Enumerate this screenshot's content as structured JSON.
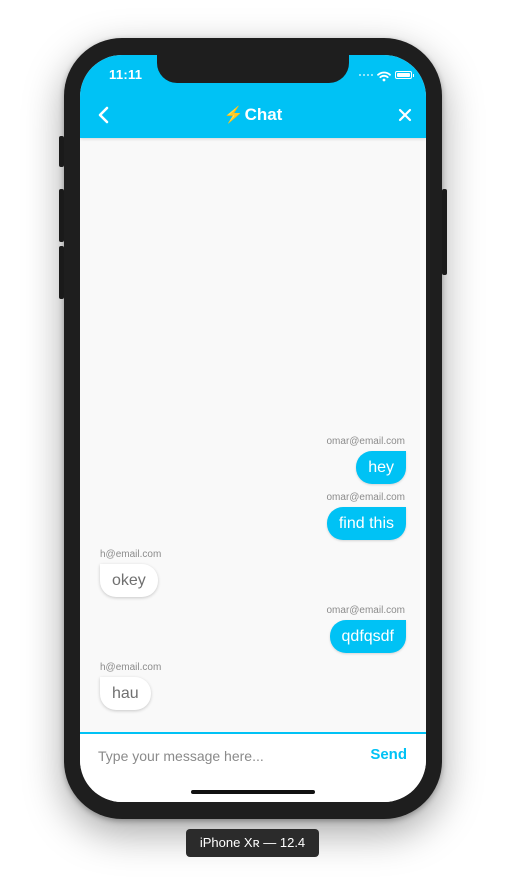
{
  "status_bar": {
    "time": "11:11",
    "icons": [
      "signal-icon",
      "wifi-icon",
      "battery-icon"
    ]
  },
  "nav": {
    "back_icon": "chevron-left-icon",
    "title_emoji": "⚡",
    "title": "Chat",
    "close_icon": "close-icon"
  },
  "messages": [
    {
      "sender": "omar@email.com",
      "text": "hey",
      "mine": true
    },
    {
      "sender": "omar@email.com",
      "text": "find this",
      "mine": true
    },
    {
      "sender": "h@email.com",
      "text": "okey",
      "mine": false
    },
    {
      "sender": "omar@email.com",
      "text": "qdfqsdf",
      "mine": true
    },
    {
      "sender": "h@email.com",
      "text": "hau",
      "mine": false
    }
  ],
  "composer": {
    "placeholder": "Type your message here...",
    "value": "",
    "send_label": "Send"
  },
  "device": {
    "label": "iPhone Xʀ — 12.4"
  },
  "colors": {
    "accent": "#00c2f5",
    "bolt": "#ffd83d",
    "screen_bg": "#f9f9f9",
    "frame": "#1e1e1e"
  }
}
